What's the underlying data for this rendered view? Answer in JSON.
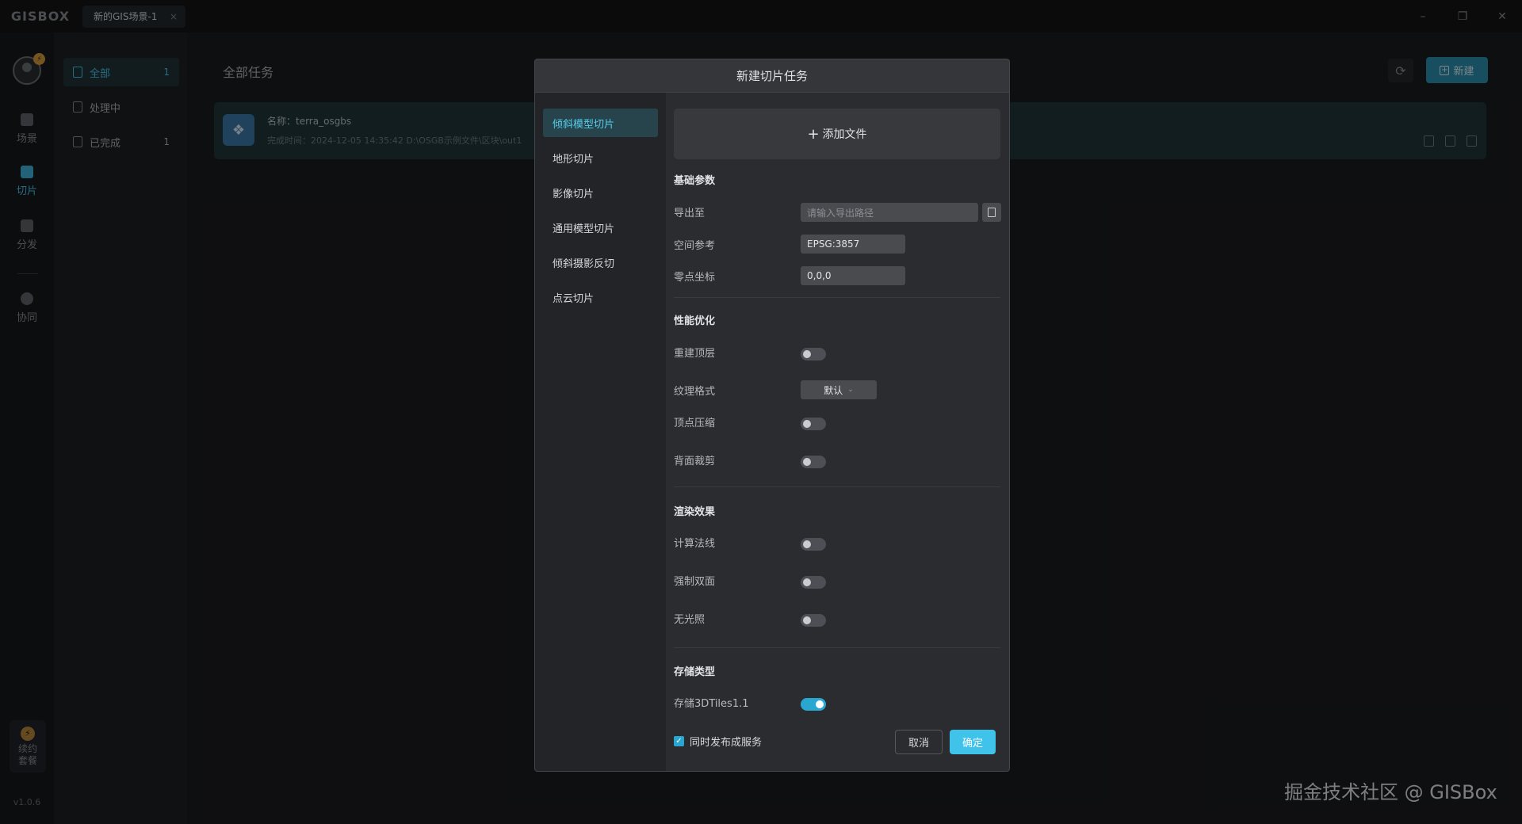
{
  "app": {
    "logo": "GISBOX"
  },
  "tab": {
    "label": "新的GIS场景-1",
    "close": "×"
  },
  "window_controls": {
    "minimize": "–",
    "restore": "❐",
    "close": "✕"
  },
  "rail": {
    "items": [
      {
        "label": "场景",
        "icon": "home-icon",
        "active": false
      },
      {
        "label": "切片",
        "icon": "slice-icon",
        "active": true
      },
      {
        "label": "分发",
        "icon": "distribute-icon",
        "active": false
      },
      {
        "label": "协同",
        "icon": "collaborate-icon",
        "active": false
      }
    ],
    "renew": {
      "line1": "续约",
      "line2": "套餐",
      "icon": "lightning-icon"
    },
    "version": "v1.0.6"
  },
  "filters": [
    {
      "label": "全部",
      "count": "1",
      "active": true
    },
    {
      "label": "处理中",
      "count": "",
      "active": false
    },
    {
      "label": "已完成",
      "count": "1",
      "active": false
    }
  ],
  "main": {
    "title": "全部任务",
    "new_button": "新建",
    "refresh_icon": "refresh-icon"
  },
  "task": {
    "name": "名称：terra_osgbs",
    "meta": "完成时间：2024-12-05 14:35:42      D:\\OSGB示例文件\\区块\\out1"
  },
  "modal": {
    "title": "新建切片任务",
    "nav": [
      {
        "label": "倾斜模型切片",
        "active": true
      },
      {
        "label": "地形切片",
        "active": false
      },
      {
        "label": "影像切片",
        "active": false
      },
      {
        "label": "通用模型切片",
        "active": false
      },
      {
        "label": "倾斜摄影反切",
        "active": false
      },
      {
        "label": "点云切片",
        "active": false
      }
    ],
    "add_file": "添加文件",
    "sections": {
      "basic": "基础参数",
      "performance": "性能优化",
      "render": "渲染效果",
      "storage": "存储类型"
    },
    "fields": {
      "export_label": "导出至",
      "export_placeholder": "请输入导出路径",
      "srs_label": "空间参考",
      "srs_value": "EPSG:3857",
      "origin_label": "零点坐标",
      "origin_value": "0,0,0",
      "rebuild_label": "重建顶层",
      "rebuild_on": false,
      "texture_label": "纹理格式",
      "texture_value": "默认",
      "vertex_label": "顶点压缩",
      "vertex_on": false,
      "backface_label": "背面裁剪",
      "backface_on": false,
      "normals_label": "计算法线",
      "normals_on": false,
      "doubleside_label": "强制双面",
      "doubleside_on": false,
      "nolight_label": "无光照",
      "nolight_on": false,
      "tiles_label": "存储3DTiles1.1",
      "tiles_on": true
    },
    "publish_label": "同时发布成服务",
    "publish_checked": true,
    "cancel": "取消",
    "ok": "确定"
  },
  "watermark": "掘金技术社区 @ GISBox",
  "colors": {
    "accent": "#3fc3ea",
    "background": "#1b1c1f",
    "modal": "#2b2c2f"
  }
}
